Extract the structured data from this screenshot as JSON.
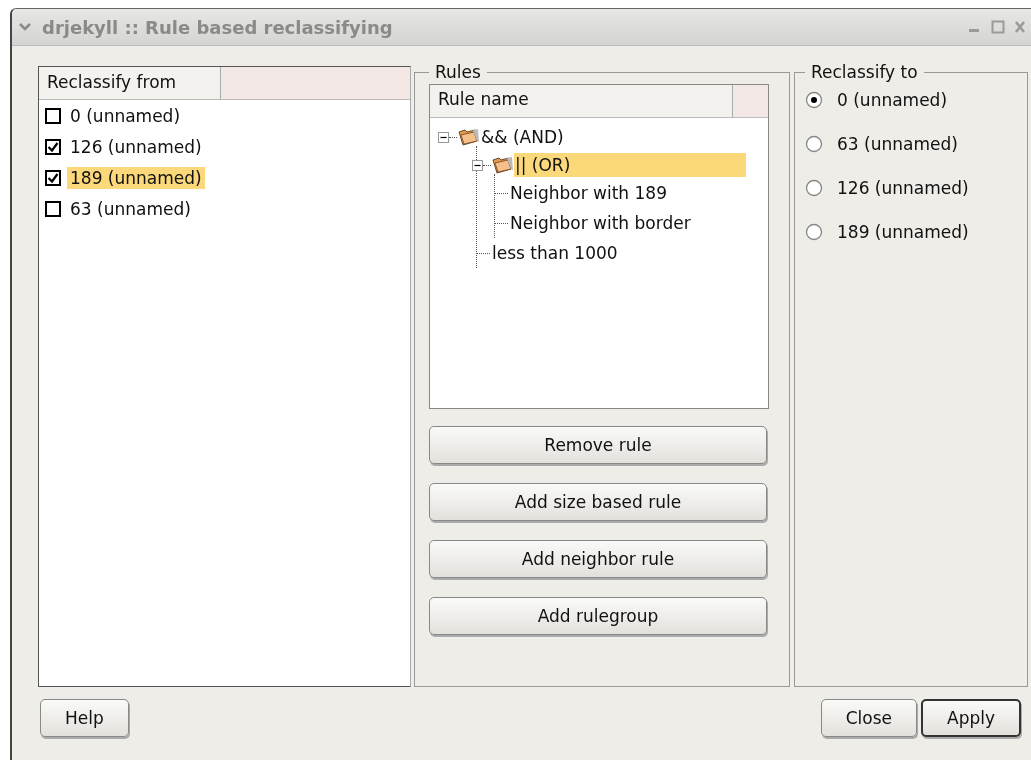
{
  "window": {
    "title": "drjekyll :: Rule based reclassifying"
  },
  "reclassify_from": {
    "header": "Reclassify from",
    "items": [
      {
        "label": "0 (unnamed)",
        "checked": false,
        "selected": false
      },
      {
        "label": "126 (unnamed)",
        "checked": true,
        "selected": false
      },
      {
        "label": "189 (unnamed)",
        "checked": true,
        "selected": true
      },
      {
        "label": "63 (unnamed)",
        "checked": false,
        "selected": false
      }
    ]
  },
  "rules": {
    "title": "Rules",
    "header": "Rule name",
    "tree": [
      {
        "label": "&& (AND)",
        "kind": "group",
        "expanded": true,
        "selected": false,
        "children": [
          {
            "label": "|| (OR)",
            "kind": "group",
            "expanded": true,
            "selected": true,
            "children": [
              {
                "label": "Neighbor with 189",
                "kind": "rule",
                "selected": false
              },
              {
                "label": "Neighbor with border",
                "kind": "rule",
                "selected": false
              }
            ]
          },
          {
            "label": "less than 1000",
            "kind": "rule",
            "selected": false
          }
        ]
      }
    ],
    "buttons": [
      "Remove rule",
      "Add size based rule",
      "Add neighbor rule",
      "Add rulegroup"
    ]
  },
  "reclassify_to": {
    "title": "Reclassify to",
    "options": [
      {
        "label": "0 (unnamed)",
        "selected": true
      },
      {
        "label": "63 (unnamed)",
        "selected": false
      },
      {
        "label": "126 (unnamed)",
        "selected": false
      },
      {
        "label": "189 (unnamed)",
        "selected": false
      }
    ]
  },
  "footer": {
    "left_buttons": [
      {
        "label": "Help",
        "default": false
      }
    ],
    "right_buttons": [
      {
        "label": "Close",
        "default": false
      },
      {
        "label": "Apply",
        "default": true
      }
    ]
  }
}
